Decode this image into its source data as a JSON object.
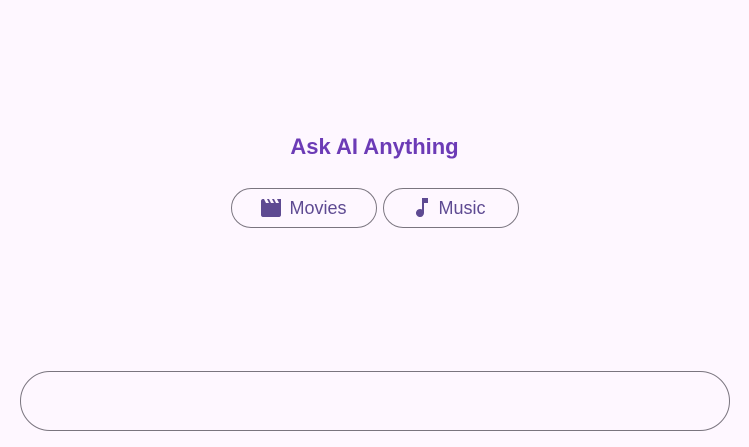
{
  "header": {
    "title": "Ask AI Anything"
  },
  "suggestions": [
    {
      "label": "Movies",
      "icon": "movie-clapperboard-icon"
    },
    {
      "label": "Music",
      "icon": "music-note-icon"
    }
  ],
  "prompt": {
    "value": "",
    "placeholder": ""
  },
  "colors": {
    "background": "#FEF7FF",
    "title": "#6C3BB6",
    "chip_text": "#5E4A92",
    "outline": "#7A757F"
  }
}
